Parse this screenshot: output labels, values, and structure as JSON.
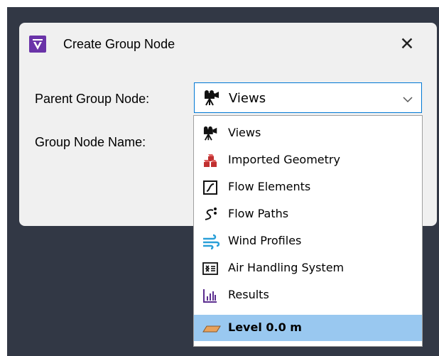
{
  "dialog": {
    "title": "Create Group Node",
    "close_glyph": "✕",
    "parent_label": "Parent Group Node:",
    "name_label": "Group Node Name:"
  },
  "combo": {
    "selected": "Views",
    "icon": "camera-icon"
  },
  "dropdown": {
    "items": [
      {
        "label": "Views",
        "icon": "camera-icon"
      },
      {
        "label": "Imported Geometry",
        "icon": "blocks-icon"
      },
      {
        "label": "Flow Elements",
        "icon": "flow-element-icon"
      },
      {
        "label": "Flow Paths",
        "icon": "flow-path-icon"
      },
      {
        "label": "Wind Profiles",
        "icon": "wind-icon"
      },
      {
        "label": "Air Handling System",
        "icon": "air-handling-icon"
      },
      {
        "label": "Results",
        "icon": "bar-chart-icon"
      },
      {
        "label": "Level 0.0 m",
        "icon": "level-plane-icon"
      }
    ],
    "highlighted": "Level 0.0 m"
  },
  "colors": {
    "accent": "#0078d4",
    "highlight": "#99c8f0",
    "app_icon": "#6a33a8",
    "backdrop": "#323845"
  }
}
